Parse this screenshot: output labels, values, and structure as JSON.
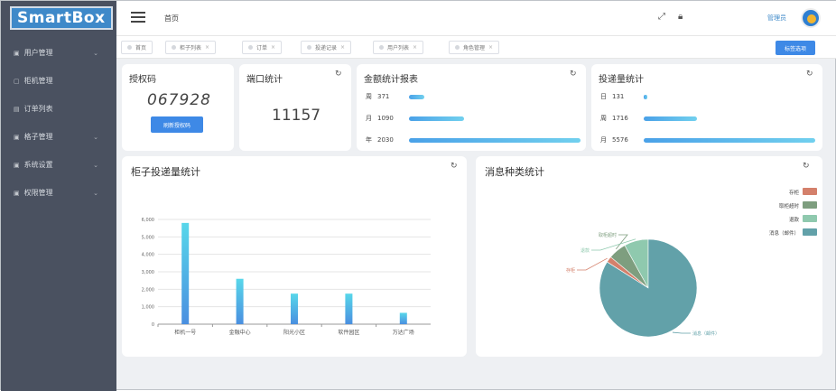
{
  "logo": "SmartBox",
  "sidebar": {
    "items": [
      {
        "label": "用户管理",
        "has_children": true
      },
      {
        "label": "柜机管理",
        "has_children": false
      },
      {
        "label": "订单列表",
        "has_children": false
      },
      {
        "label": "格子管理",
        "has_children": true
      },
      {
        "label": "系统设置",
        "has_children": true
      },
      {
        "label": "权限管理",
        "has_children": true
      }
    ]
  },
  "header": {
    "breadcrumb": "首页",
    "username": "管理员"
  },
  "tabs": [
    {
      "label": "首页"
    },
    {
      "label": "柜子列表"
    },
    {
      "label": "订单"
    },
    {
      "label": "投递记录"
    },
    {
      "label": "用户列表"
    },
    {
      "label": "角色管理"
    }
  ],
  "tab_action": "标签选项",
  "cards": {
    "auth": {
      "title": "授权码",
      "value": "067928",
      "button": "刷新授权码"
    },
    "ports": {
      "title": "端口统计",
      "value": "11157"
    },
    "orders": {
      "title": "金额统计报表",
      "rows": [
        {
          "label": "周",
          "value": "371",
          "fraction": 0.09
        },
        {
          "label": "月",
          "value": "1090",
          "fraction": 0.32
        },
        {
          "label": "年",
          "value": "2030",
          "fraction": 1.0
        }
      ]
    },
    "delivery": {
      "title": "投递量统计",
      "rows": [
        {
          "label": "日",
          "value": "131",
          "fraction": 0.02
        },
        {
          "label": "周",
          "value": "1716",
          "fraction": 0.31
        },
        {
          "label": "月",
          "value": "5576",
          "fraction": 1.0
        }
      ]
    }
  },
  "bar_chart_title": "柜子投递量统计",
  "pie_chart_title": "消息种类统计",
  "chart_data": [
    {
      "type": "bar",
      "categories": [
        "柜机一号",
        "金融中心",
        "阳光小区",
        "软件园区",
        "万达广场"
      ],
      "values": [
        5800,
        2600,
        1750,
        1750,
        650
      ],
      "yticks": [
        "0",
        "1,000",
        "2,000",
        "3,000",
        "4,000",
        "5,000",
        "6,000"
      ],
      "ylim": [
        0,
        6000
      ]
    },
    {
      "type": "pie",
      "labels": [
        "存柜",
        "取柜超时",
        "退款",
        "消息（邮件）"
      ],
      "values": [
        2,
        6,
        8,
        84
      ],
      "colors": [
        "#d4806b",
        "#7e9e7f",
        "#8fc9ae",
        "#62a1a9"
      ],
      "legend": [
        "存柜",
        "取柜超时",
        "退款",
        "消息（邮件）"
      ],
      "legend_position": "top-right"
    }
  ]
}
